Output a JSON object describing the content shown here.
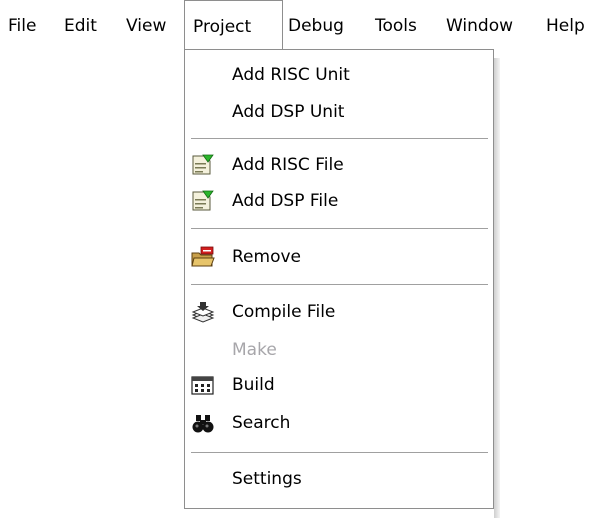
{
  "menubar": {
    "items": [
      {
        "label": "File"
      },
      {
        "label": "Edit"
      },
      {
        "label": "View"
      },
      {
        "label": "Project"
      },
      {
        "label": "Debug"
      },
      {
        "label": "Tools"
      },
      {
        "label": "Window"
      },
      {
        "label": "Help"
      }
    ]
  },
  "project_menu": {
    "items": [
      {
        "label": "Add RISC Unit",
        "icon": null,
        "enabled": true
      },
      {
        "label": "Add DSP Unit",
        "icon": null,
        "enabled": true
      },
      {
        "label": "Add RISC File",
        "icon": "add-file-icon",
        "enabled": true
      },
      {
        "label": "Add DSP File",
        "icon": "add-file-icon",
        "enabled": true
      },
      {
        "label": "Remove",
        "icon": "remove-icon",
        "enabled": true
      },
      {
        "label": "Compile File",
        "icon": "compile-icon",
        "enabled": true
      },
      {
        "label": "Make",
        "icon": null,
        "enabled": false
      },
      {
        "label": "Build",
        "icon": "build-icon",
        "enabled": true
      },
      {
        "label": "Search",
        "icon": "binoculars-icon",
        "enabled": true
      },
      {
        "label": "Settings",
        "icon": null,
        "enabled": true
      }
    ]
  }
}
